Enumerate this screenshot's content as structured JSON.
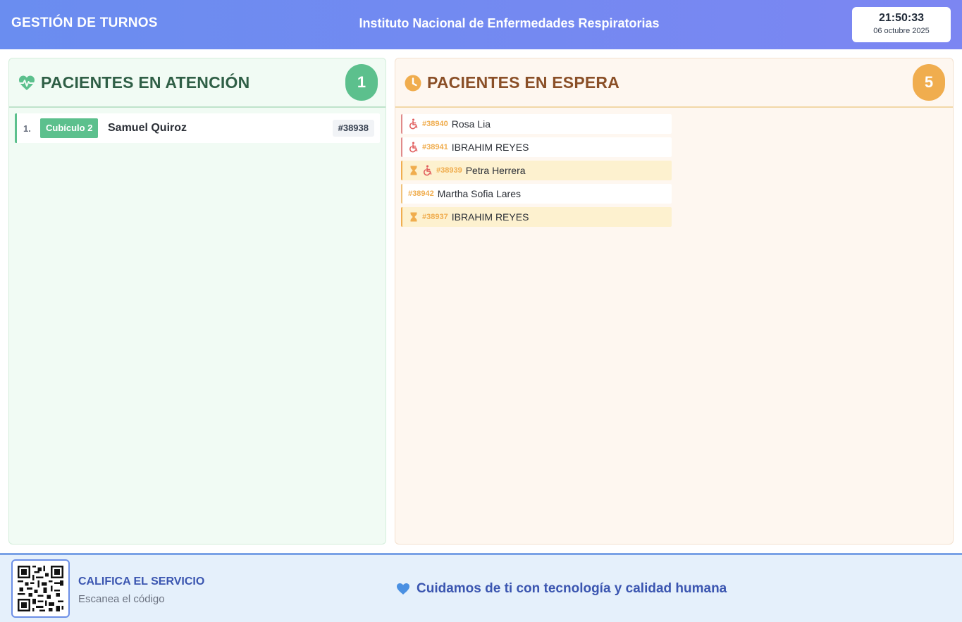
{
  "header": {
    "app_title": "GESTIÓN DE TURNOS",
    "institution": "Instituto Nacional de Enfermedades Respiratorias",
    "time": "21:50:33",
    "date": "06 octubre 2025"
  },
  "attention": {
    "title": "PACIENTES EN ATENCIÓN",
    "count": "1",
    "icon": "heartbeat-icon",
    "rows": [
      {
        "index": "1.",
        "cubicle": "Cubículo 2",
        "name": "Samuel Quiroz",
        "ticket": "#38938"
      }
    ]
  },
  "waiting": {
    "title": "PACIENTES EN ESPERA",
    "count": "5",
    "icon": "clock-icon",
    "rows": [
      {
        "ticket": "#38940",
        "name": "Rosa Lia",
        "icons": [
          "wheelchair-icon"
        ],
        "status": "priority"
      },
      {
        "ticket": "#38941",
        "name": "IBRAHIM REYES",
        "icons": [
          "wheelchair-icon"
        ],
        "status": "priority"
      },
      {
        "ticket": "#38939",
        "name": "Petra Herrera",
        "icons": [
          "hourglass-icon",
          "wheelchair-icon"
        ],
        "status": "late"
      },
      {
        "ticket": "#38942",
        "name": "Martha Sofia Lares",
        "icons": [],
        "status": "normal"
      },
      {
        "ticket": "#38937",
        "name": "IBRAHIM REYES",
        "icons": [
          "hourglass-icon"
        ],
        "status": "late"
      }
    ]
  },
  "footer": {
    "rate_title": "CALIFICA EL SERVICIO",
    "rate_subtitle": "Escanea el código",
    "slogan": "Cuidamos de ti con tecnología y calidad humana",
    "qr": "qr-code-icon"
  },
  "colors": {
    "header_start": "#6a8df0",
    "attention_accent": "#5cc08d",
    "waiting_accent": "#f0ad4e",
    "priority": "#e05a5a",
    "footer_text": "#3a55b0"
  }
}
